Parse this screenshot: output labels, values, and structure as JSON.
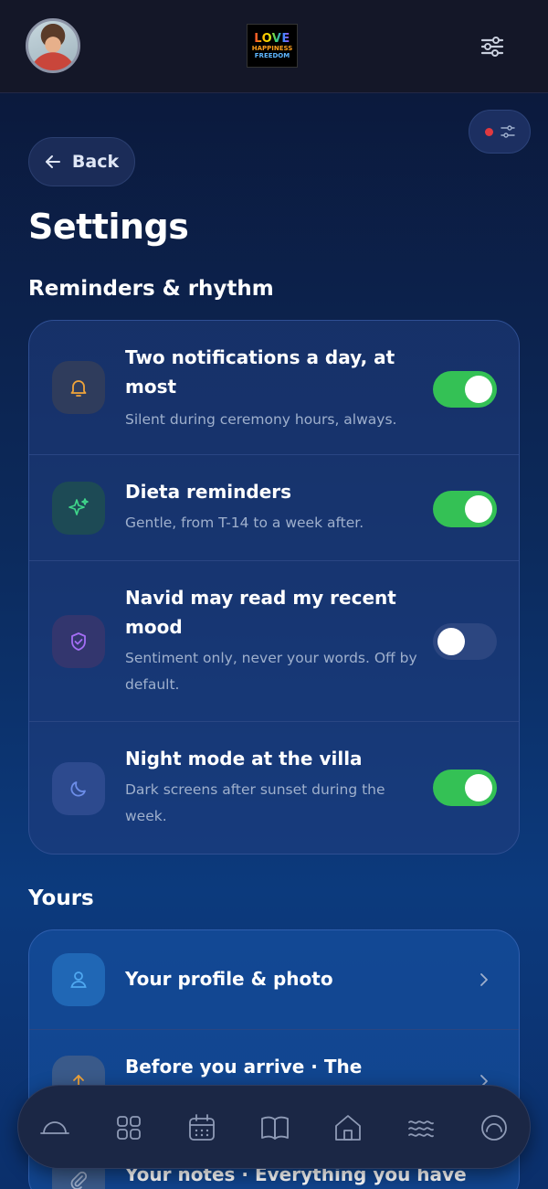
{
  "header": {
    "logo_line1": "LOVE",
    "logo_line2": "HAPPINESS",
    "logo_line3": "FREEDOM"
  },
  "back_label": "Back",
  "page_title": "Settings",
  "sections": [
    {
      "title": "Reminders & rhythm",
      "items": [
        {
          "title": "Two notifications a day, at most",
          "subtitle": "Silent during ceremony hours, always.",
          "icon": "bell-icon",
          "toggle": true
        },
        {
          "title": "Dieta reminders",
          "subtitle": "Gentle, from T-14 to a week after.",
          "icon": "sparkle-icon",
          "toggle": true
        },
        {
          "title": "Navid may read my recent mood",
          "subtitle": "Sentiment only, never your words. Off by default.",
          "icon": "shield-check-icon",
          "toggle": false
        },
        {
          "title": "Night mode at the villa",
          "subtitle": "Dark screens after sunset during the week.",
          "icon": "moon-icon",
          "toggle": true
        }
      ]
    },
    {
      "title": "Yours",
      "items": [
        {
          "title": "Your profile & photo",
          "icon": "user-icon"
        },
        {
          "title": "Before you arrive · The",
          "icon": "upload-icon"
        },
        {
          "title": "Your notes · Everything you have",
          "icon": "paperclip-icon"
        }
      ]
    }
  ],
  "colors": {
    "toggle_on": "#34c155",
    "toggle_off": "#2c4680",
    "accent_red": "#e0393f",
    "bell": "#f0a43a",
    "sparkle": "#3fd68a",
    "shield": "#a46ef5",
    "moon": "#6c8de8",
    "user": "#4fa8f0"
  },
  "nav_items": [
    "horizon-icon",
    "grid-icon",
    "calendar-icon",
    "book-icon",
    "home-icon",
    "waves-icon",
    "circle-gauge-icon"
  ]
}
